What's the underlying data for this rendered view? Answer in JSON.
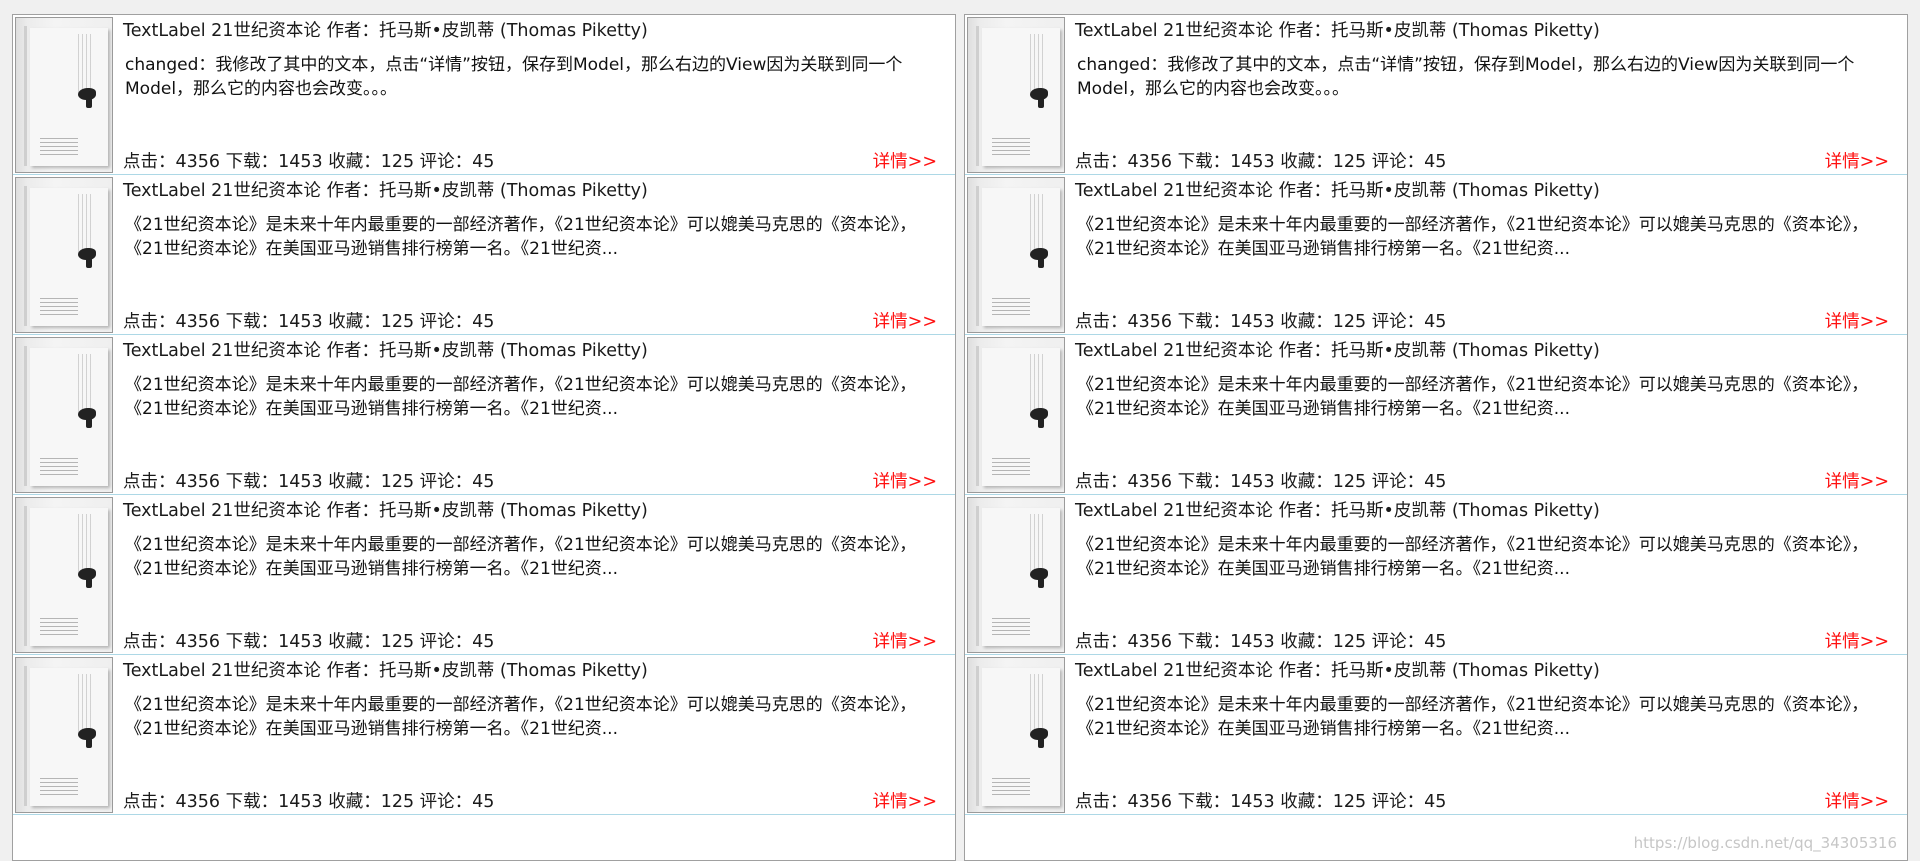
{
  "left_panel": {
    "items": [
      {
        "title": "TextLabel 21世纪资本论 作者：托马斯•皮凯蒂 (Thomas Piketty)",
        "description": "changed：我修改了其中的文本，点击“详情”按钮，保存到Model，那么右边的View因为关联到同一个Model，那么它的内容也会改变。。。",
        "stats": "点击：4356  下载：1453  收藏：125  评论：45",
        "detail": "详情>>"
      },
      {
        "title": "TextLabel 21世纪资本论 作者：托马斯•皮凯蒂 (Thomas Piketty)",
        "description": "《21世纪资本论》是未来十年内最重要的一部经济著作，《21世纪资本论》可以媲美马克思的《资本论》，《21世纪资本论》在美国亚马逊销售排行榜第一名。《21世纪资...",
        "stats": "点击：4356  下载：1453  收藏：125  评论：45",
        "detail": "详情>>"
      },
      {
        "title": "TextLabel 21世纪资本论 作者：托马斯•皮凯蒂 (Thomas Piketty)",
        "description": "《21世纪资本论》是未来十年内最重要的一部经济著作，《21世纪资本论》可以媲美马克思的《资本论》，《21世纪资本论》在美国亚马逊销售排行榜第一名。《21世纪资...",
        "stats": "点击：4356  下载：1453  收藏：125  评论：45",
        "detail": "详情>>"
      },
      {
        "title": "TextLabel 21世纪资本论 作者：托马斯•皮凯蒂 (Thomas Piketty)",
        "description": "《21世纪资本论》是未来十年内最重要的一部经济著作，《21世纪资本论》可以媲美马克思的《资本论》，《21世纪资本论》在美国亚马逊销售排行榜第一名。《21世纪资...",
        "stats": "点击：4356  下载：1453  收藏：125  评论：45",
        "detail": "详情>>"
      },
      {
        "title": "TextLabel 21世纪资本论 作者：托马斯•皮凯蒂 (Thomas Piketty)",
        "description": "《21世纪资本论》是未来十年内最重要的一部经济著作，《21世纪资本论》可以媲美马克思的《资本论》，《21世纪资本论》在美国亚马逊销售排行榜第一名。《21世纪资...",
        "stats": "点击：4356  下载：1453  收藏：125  评论：45",
        "detail": "详情>>"
      }
    ]
  },
  "right_panel": {
    "items": [
      {
        "title": "TextLabel 21世纪资本论 作者：托马斯•皮凯蒂 (Thomas Piketty)",
        "description": "changed：我修改了其中的文本，点击“详情”按钮，保存到Model，那么右边的View因为关联到同一个Model，那么它的内容也会改变。。。",
        "stats": "点击：4356  下载：1453  收藏：125  评论：45",
        "detail": "详情>>"
      },
      {
        "title": "TextLabel 21世纪资本论 作者：托马斯•皮凯蒂 (Thomas Piketty)",
        "description": "《21世纪资本论》是未来十年内最重要的一部经济著作，《21世纪资本论》可以媲美马克思的《资本论》，《21世纪资本论》在美国亚马逊销售排行榜第一名。《21世纪资...",
        "stats": "点击：4356  下载：1453  收藏：125  评论：45",
        "detail": "详情>>"
      },
      {
        "title": "TextLabel 21世纪资本论 作者：托马斯•皮凯蒂 (Thomas Piketty)",
        "description": "《21世纪资本论》是未来十年内最重要的一部经济著作，《21世纪资本论》可以媲美马克思的《资本论》，《21世纪资本论》在美国亚马逊销售排行榜第一名。《21世纪资...",
        "stats": "点击：4356  下载：1453  收藏：125  评论：45",
        "detail": "详情>>"
      },
      {
        "title": "TextLabel 21世纪资本论 作者：托马斯•皮凯蒂 (Thomas Piketty)",
        "description": "《21世纪资本论》是未来十年内最重要的一部经济著作，《21世纪资本论》可以媲美马克思的《资本论》，《21世纪资本论》在美国亚马逊销售排行榜第一名。《21世纪资...",
        "stats": "点击：4356  下载：1453  收藏：125  评论：45",
        "detail": "详情>>"
      },
      {
        "title": "TextLabel 21世纪资本论 作者：托马斯•皮凯蒂 (Thomas Piketty)",
        "description": "《21世纪资本论》是未来十年内最重要的一部经济著作，《21世纪资本论》可以媲美马克思的《资本论》，《21世纪资本论》在美国亚马逊销售排行榜第一名。《21世纪资...",
        "stats": "点击：4356  下载：1453  收藏：125  评论：45",
        "detail": "详情>>"
      }
    ]
  },
  "watermark": "https://blog.csdn.net/qq_34305316",
  "colors": {
    "detail_link": "#ff1010",
    "row_divider": "#add8e6"
  }
}
